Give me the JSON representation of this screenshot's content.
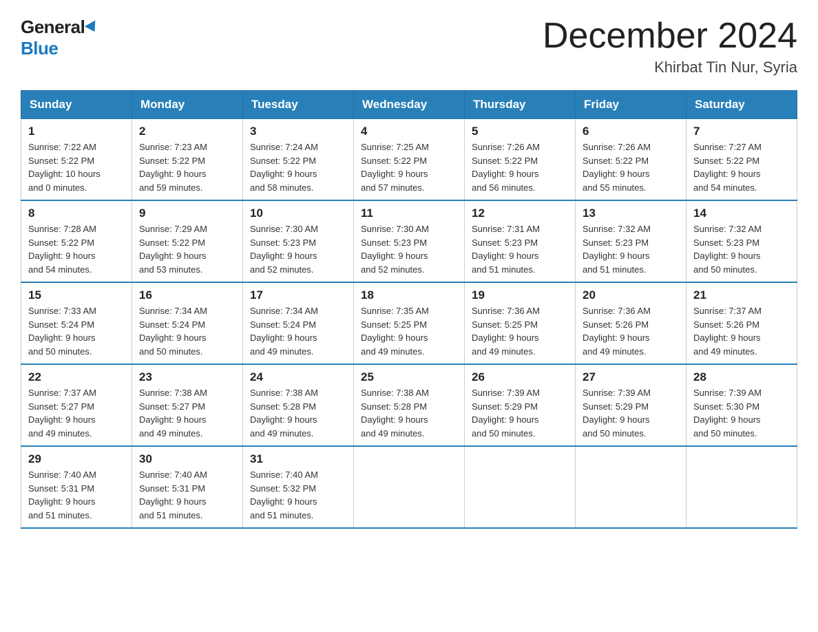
{
  "logo": {
    "general": "General",
    "blue": "Blue"
  },
  "title": "December 2024",
  "subtitle": "Khirbat Tin Nur, Syria",
  "days_of_week": [
    "Sunday",
    "Monday",
    "Tuesday",
    "Wednesday",
    "Thursday",
    "Friday",
    "Saturday"
  ],
  "weeks": [
    [
      {
        "day": 1,
        "sunrise": "7:22 AM",
        "sunset": "5:22 PM",
        "daylight": "10 hours and 0 minutes."
      },
      {
        "day": 2,
        "sunrise": "7:23 AM",
        "sunset": "5:22 PM",
        "daylight": "9 hours and 59 minutes."
      },
      {
        "day": 3,
        "sunrise": "7:24 AM",
        "sunset": "5:22 PM",
        "daylight": "9 hours and 58 minutes."
      },
      {
        "day": 4,
        "sunrise": "7:25 AM",
        "sunset": "5:22 PM",
        "daylight": "9 hours and 57 minutes."
      },
      {
        "day": 5,
        "sunrise": "7:26 AM",
        "sunset": "5:22 PM",
        "daylight": "9 hours and 56 minutes."
      },
      {
        "day": 6,
        "sunrise": "7:26 AM",
        "sunset": "5:22 PM",
        "daylight": "9 hours and 55 minutes."
      },
      {
        "day": 7,
        "sunrise": "7:27 AM",
        "sunset": "5:22 PM",
        "daylight": "9 hours and 54 minutes."
      }
    ],
    [
      {
        "day": 8,
        "sunrise": "7:28 AM",
        "sunset": "5:22 PM",
        "daylight": "9 hours and 54 minutes."
      },
      {
        "day": 9,
        "sunrise": "7:29 AM",
        "sunset": "5:22 PM",
        "daylight": "9 hours and 53 minutes."
      },
      {
        "day": 10,
        "sunrise": "7:30 AM",
        "sunset": "5:23 PM",
        "daylight": "9 hours and 52 minutes."
      },
      {
        "day": 11,
        "sunrise": "7:30 AM",
        "sunset": "5:23 PM",
        "daylight": "9 hours and 52 minutes."
      },
      {
        "day": 12,
        "sunrise": "7:31 AM",
        "sunset": "5:23 PM",
        "daylight": "9 hours and 51 minutes."
      },
      {
        "day": 13,
        "sunrise": "7:32 AM",
        "sunset": "5:23 PM",
        "daylight": "9 hours and 51 minutes."
      },
      {
        "day": 14,
        "sunrise": "7:32 AM",
        "sunset": "5:23 PM",
        "daylight": "9 hours and 50 minutes."
      }
    ],
    [
      {
        "day": 15,
        "sunrise": "7:33 AM",
        "sunset": "5:24 PM",
        "daylight": "9 hours and 50 minutes."
      },
      {
        "day": 16,
        "sunrise": "7:34 AM",
        "sunset": "5:24 PM",
        "daylight": "9 hours and 50 minutes."
      },
      {
        "day": 17,
        "sunrise": "7:34 AM",
        "sunset": "5:24 PM",
        "daylight": "9 hours and 49 minutes."
      },
      {
        "day": 18,
        "sunrise": "7:35 AM",
        "sunset": "5:25 PM",
        "daylight": "9 hours and 49 minutes."
      },
      {
        "day": 19,
        "sunrise": "7:36 AM",
        "sunset": "5:25 PM",
        "daylight": "9 hours and 49 minutes."
      },
      {
        "day": 20,
        "sunrise": "7:36 AM",
        "sunset": "5:26 PM",
        "daylight": "9 hours and 49 minutes."
      },
      {
        "day": 21,
        "sunrise": "7:37 AM",
        "sunset": "5:26 PM",
        "daylight": "9 hours and 49 minutes."
      }
    ],
    [
      {
        "day": 22,
        "sunrise": "7:37 AM",
        "sunset": "5:27 PM",
        "daylight": "9 hours and 49 minutes."
      },
      {
        "day": 23,
        "sunrise": "7:38 AM",
        "sunset": "5:27 PM",
        "daylight": "9 hours and 49 minutes."
      },
      {
        "day": 24,
        "sunrise": "7:38 AM",
        "sunset": "5:28 PM",
        "daylight": "9 hours and 49 minutes."
      },
      {
        "day": 25,
        "sunrise": "7:38 AM",
        "sunset": "5:28 PM",
        "daylight": "9 hours and 49 minutes."
      },
      {
        "day": 26,
        "sunrise": "7:39 AM",
        "sunset": "5:29 PM",
        "daylight": "9 hours and 50 minutes."
      },
      {
        "day": 27,
        "sunrise": "7:39 AM",
        "sunset": "5:29 PM",
        "daylight": "9 hours and 50 minutes."
      },
      {
        "day": 28,
        "sunrise": "7:39 AM",
        "sunset": "5:30 PM",
        "daylight": "9 hours and 50 minutes."
      }
    ],
    [
      {
        "day": 29,
        "sunrise": "7:40 AM",
        "sunset": "5:31 PM",
        "daylight": "9 hours and 51 minutes."
      },
      {
        "day": 30,
        "sunrise": "7:40 AM",
        "sunset": "5:31 PM",
        "daylight": "9 hours and 51 minutes."
      },
      {
        "day": 31,
        "sunrise": "7:40 AM",
        "sunset": "5:32 PM",
        "daylight": "9 hours and 51 minutes."
      },
      null,
      null,
      null,
      null
    ]
  ]
}
